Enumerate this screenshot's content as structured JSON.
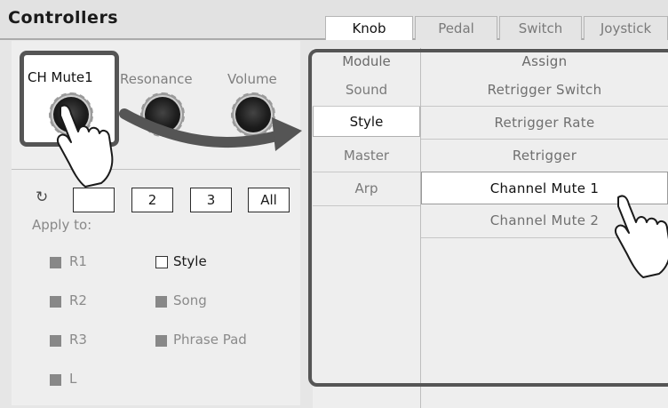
{
  "header": {
    "title": "Controllers",
    "tabs": [
      {
        "label": "Knob",
        "active": true
      },
      {
        "label": "Pedal",
        "active": false
      },
      {
        "label": "Switch",
        "active": false
      },
      {
        "label": "Joystick",
        "active": false
      }
    ]
  },
  "knobs": [
    {
      "label": "CH Mute1",
      "selected": true
    },
    {
      "label": "Resonance",
      "selected": false
    },
    {
      "label": "Volume",
      "selected": false
    }
  ],
  "page_buttons": {
    "refresh_icon": "refresh-icon",
    "items": [
      "",
      "2",
      "3",
      "All"
    ]
  },
  "apply": {
    "label": "Apply to:",
    "options": [
      {
        "label": "R1",
        "state": "checked-disabled"
      },
      {
        "label": "Style",
        "state": "unchecked"
      },
      {
        "label": "R2",
        "state": "checked-disabled"
      },
      {
        "label": "Song",
        "state": "checked-disabled"
      },
      {
        "label": "R3",
        "state": "checked-disabled"
      },
      {
        "label": "Phrase Pad",
        "state": "checked-disabled"
      },
      {
        "label": "L",
        "state": "checked-disabled"
      }
    ]
  },
  "table": {
    "module_header": "Module",
    "assign_header": "Assign",
    "modules": [
      {
        "label": "Sound",
        "selected": false
      },
      {
        "label": "Style",
        "selected": true
      },
      {
        "label": "Master",
        "selected": false
      },
      {
        "label": "Arp",
        "selected": false
      }
    ],
    "assigns": [
      {
        "label": "Retrigger Switch",
        "selected": false
      },
      {
        "label": "Retrigger Rate",
        "selected": false
      },
      {
        "label": "Retrigger",
        "selected": false
      },
      {
        "label": "Channel Mute 1",
        "selected": true
      },
      {
        "label": "Channel Mute 2",
        "selected": false
      }
    ]
  },
  "overlay": {
    "arrow": "curved-arrow",
    "hand_icons": [
      "hand-pointer-icon",
      "hand-pointer-icon"
    ]
  },
  "colors": {
    "panel": "#eeeeee",
    "selected": "#ffffff",
    "highlight_outline": "#555555",
    "arrow": "#555555"
  }
}
